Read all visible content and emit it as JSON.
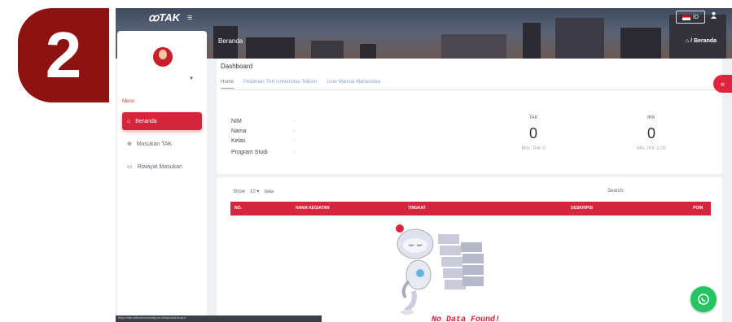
{
  "step_badge": "2",
  "app": {
    "logo": "ꝏTAK",
    "hamburger": "≡",
    "lang_flag_label": "ID",
    "breadcrumb_page": "Beranda",
    "breadcrumb_path": "⌂ / Beranda"
  },
  "sidebar": {
    "menu_title": "Menu",
    "items": [
      {
        "label": "Beranda",
        "icon": "home-icon",
        "active": true
      },
      {
        "label": "Masukan TAK",
        "icon": "plus-circle-icon",
        "active": false
      },
      {
        "label": "Riwayat Masukan",
        "icon": "folder-icon",
        "active": false
      }
    ]
  },
  "dashboard": {
    "title": "Dashboard",
    "tabs": [
      "Home",
      "Pedoman TAK Universitas Telkom",
      "User Manual Mahasiswa"
    ],
    "info": [
      {
        "label": "NIM",
        "value": "-"
      },
      {
        "label": "Nama",
        "value": "-"
      },
      {
        "label": "Kelas",
        "value": "-"
      },
      {
        "label": "Program Studi",
        "value": "-"
      }
    ],
    "stats": [
      {
        "label": "TAK",
        "value": "0",
        "min": "Min. TAK 0"
      },
      {
        "label": "IKK",
        "value": "0",
        "min": "Min. IKK 2,00"
      }
    ]
  },
  "table": {
    "show_label": "Show",
    "entries": "10",
    "data_label": "data",
    "search_label": "Search:",
    "columns": [
      "NO.",
      "NAMA KEGIATAN",
      "TINGKAT",
      "DESKRIPSI",
      "POIN"
    ],
    "empty_text": "No Data Found!"
  },
  "status_url": "https://tak.telkomuniversity.ac.id/tak/dashboard",
  "colors": {
    "accent": "#d6263d",
    "badge": "#8e1212",
    "whatsapp": "#25c463"
  }
}
